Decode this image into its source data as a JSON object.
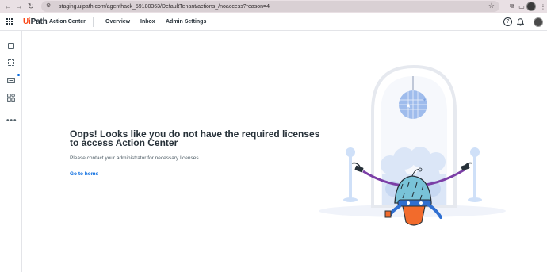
{
  "browser": {
    "url": "staging.uipath.com/agenthack_59180363/DefaultTenant/actions_/noaccess?reason=4"
  },
  "header": {
    "brand_ui": "Ui",
    "brand_path": "Path",
    "product": "Action Center",
    "nav": {
      "overview": "Overview",
      "inbox": "Inbox",
      "admin": "Admin Settings"
    },
    "help_glyph": "?"
  },
  "rail": {
    "more_glyph": "•••"
  },
  "main": {
    "headline": "Oops! Looks like you do not have the required licenses to access Action Center",
    "subtext": "Please contact your administrator for necessary licenses.",
    "home_link": "Go to home"
  },
  "colors": {
    "accent": "#0067df",
    "brand": "#fa4616",
    "text": "#273139"
  }
}
